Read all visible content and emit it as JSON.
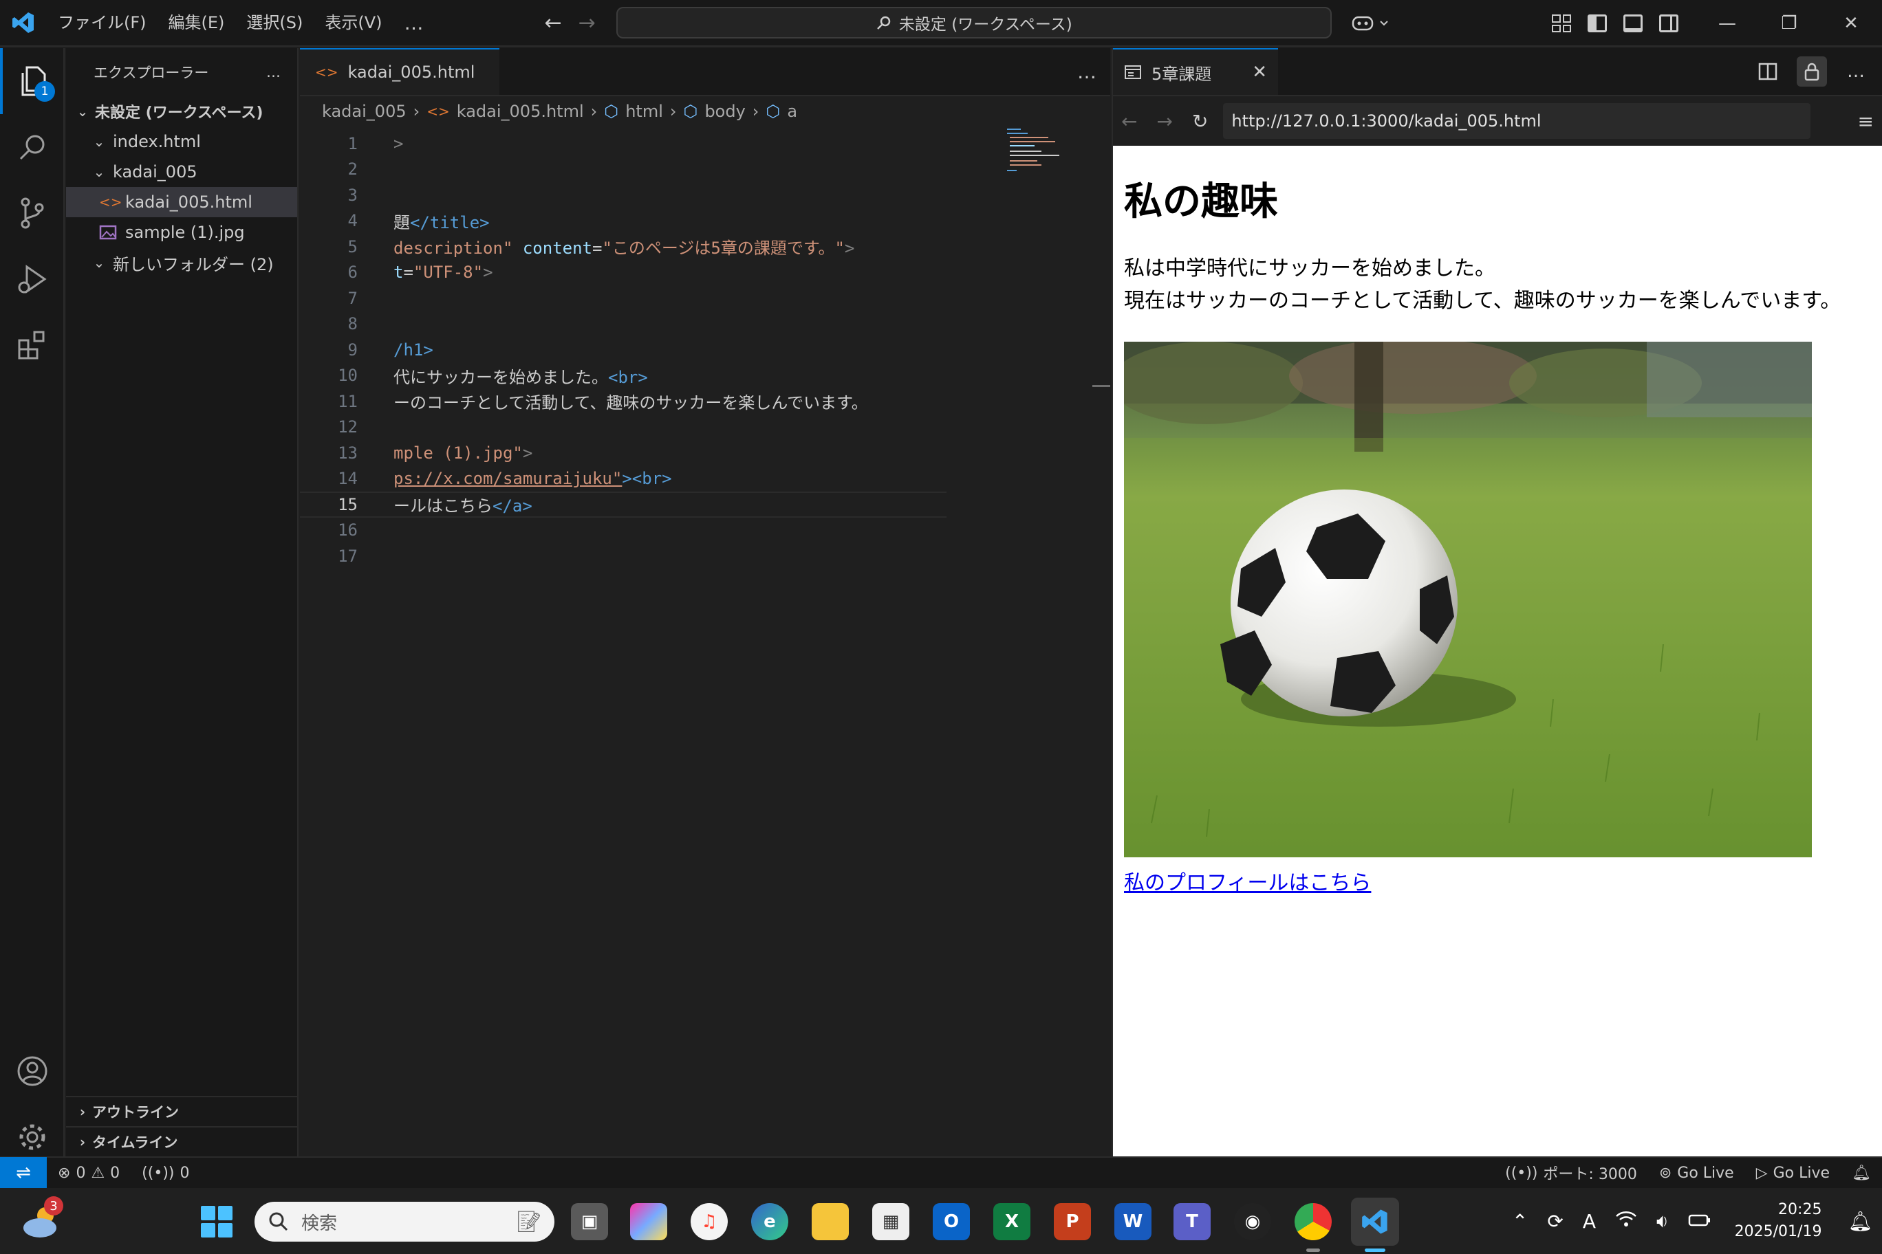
{
  "titlebar": {
    "menus": [
      "ファイル(F)",
      "編集(E)",
      "選択(S)",
      "表示(V)"
    ],
    "more": "…",
    "command_center": "未設定 (ワークスペース)"
  },
  "activitybar": {
    "explorer_badge": "1"
  },
  "sidebar": {
    "title": "エクスプローラー",
    "more": "…",
    "workspace": "未設定 (ワークスペース)",
    "items": [
      {
        "label": "index.html"
      },
      {
        "label": "kadai_005"
      },
      {
        "label": "kadai_005.html"
      },
      {
        "label": "sample (1).jpg"
      },
      {
        "label": "新しいフォルダー (2)"
      }
    ],
    "outline": "アウトライン",
    "timeline": "タイムライン"
  },
  "editor": {
    "tab_label": "kadai_005.html",
    "breadcrumb": [
      "kadai_005",
      "kadai_005.html",
      "html",
      "body",
      "a"
    ],
    "line_numbers": [
      "1",
      "2",
      "3",
      "4",
      "5",
      "6",
      "7",
      "8",
      "9",
      "10",
      "11",
      "12",
      "13",
      "14",
      "15",
      "16",
      "17"
    ],
    "lines": {
      "l1": ">",
      "l4_text": "題",
      "l4_close": "</title>",
      "l5_attr": "description\"",
      "l5_attr2": "content",
      "l5_eq": "=",
      "l5_str": "\"このページは5章の課題です。\"",
      "l5_close": ">",
      "l6_attr": "t",
      "l6_eq": "=",
      "l6_str": "\"UTF-8\"",
      "l6_close": ">",
      "l9": "/h1>",
      "l10_text": "代にサッカーを始めました。",
      "l10_tag": "<br>",
      "l11_text": "ーのコーチとして活動して、趣味のサッカーを楽しんでいます。",
      "l13_str": "mple (1).jpg\"",
      "l13_close": ">",
      "l14_str": "ps://x.com/samuraijuku\"",
      "l14_close": "><br>",
      "l15_text": "ールはこちら",
      "l15_close": "</a>"
    }
  },
  "browser": {
    "tab_label": "5章課題",
    "url": "http://127.0.0.1:3000/kadai_005.html",
    "page": {
      "heading": "私の趣味",
      "para_line1": "私は中学時代にサッカーを始めました。",
      "para_line2": "現在はサッカーのコーチとして活動して、趣味のサッカーを楽しんでいます。",
      "link": "私のプロフィールはこちら"
    }
  },
  "statusbar": {
    "errors": "0",
    "warnings": "0",
    "ports": "0",
    "port": "ポート: 3000",
    "golive1": "Go Live",
    "golive2": "Go Live"
  },
  "taskbar": {
    "weather_badge": "3",
    "search_placeholder": "検索",
    "time": "20:25",
    "date": "2025/01/19",
    "ime": "A"
  },
  "colors": {
    "accent": "#0078d4",
    "editor_bg": "#1f1f1f",
    "string": "#ce9178",
    "tag": "#569cd6",
    "attr": "#9cdcfe"
  }
}
